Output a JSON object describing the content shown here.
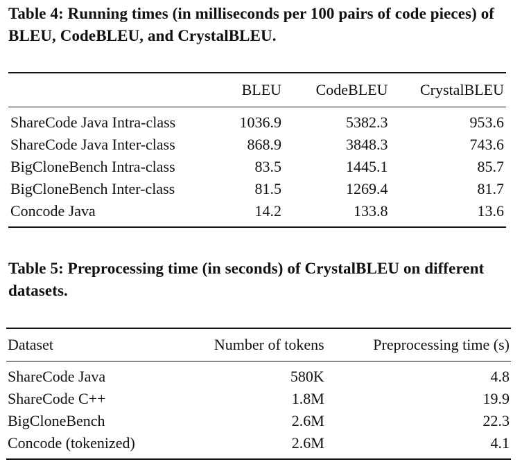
{
  "table4": {
    "caption": "Table 4: Running times (in milliseconds per 100 pairs of code pieces) of BLEU, CodeBLEU, and CrystalBLEU.",
    "columns": [
      "",
      "BLEU",
      "CodeBLEU",
      "CrystalBLEU"
    ],
    "rows": [
      [
        "ShareCode Java Intra-class",
        "1036.9",
        "5382.3",
        "953.6"
      ],
      [
        "ShareCode Java Inter-class",
        "868.9",
        "3848.3",
        "743.6"
      ],
      [
        "BigCloneBench Intra-class",
        "83.5",
        "1445.1",
        "85.7"
      ],
      [
        "BigCloneBench Inter-class",
        "81.5",
        "1269.4",
        "81.7"
      ],
      [
        "Concode Java",
        "14.2",
        "133.8",
        "13.6"
      ]
    ]
  },
  "table5": {
    "caption": "Table 5: Preprocessing time (in seconds) of CrystalBLEU on different datasets.",
    "columns": [
      "Dataset",
      "Number of tokens",
      "Preprocessing time (s)"
    ],
    "rows": [
      [
        "ShareCode Java",
        "580K",
        "4.8"
      ],
      [
        "ShareCode C++",
        "1.8M",
        "19.9"
      ],
      [
        "BigCloneBench",
        "2.6M",
        "22.3"
      ],
      [
        "Concode (tokenized)",
        "2.6M",
        "4.1"
      ]
    ]
  }
}
